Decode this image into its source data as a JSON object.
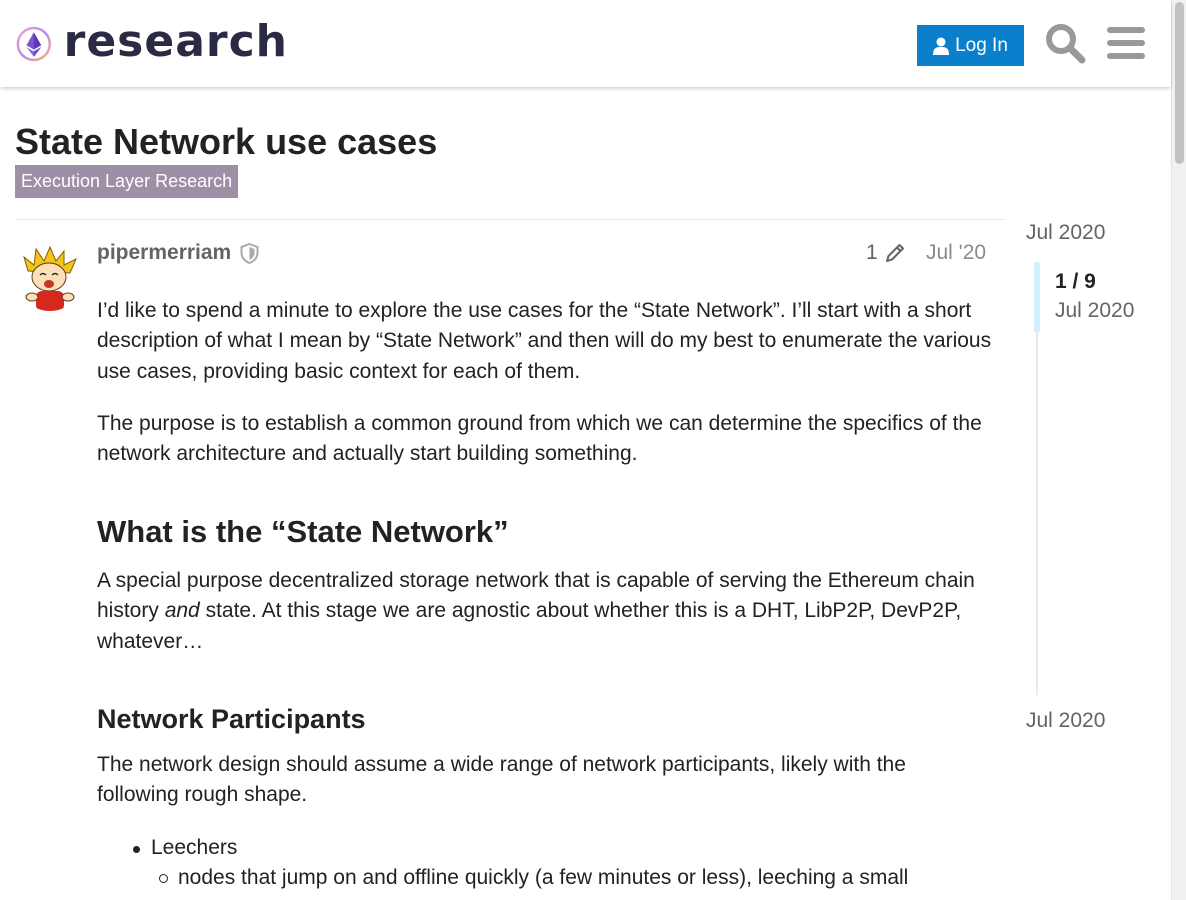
{
  "header": {
    "logo_text": "research",
    "login_label": "Log In",
    "search_icon": "search-icon",
    "menu_icon": "hamburger-menu-icon"
  },
  "topic": {
    "title": "State Network use cases",
    "category": "Execution Layer Research",
    "category_color": "#9c8fa6"
  },
  "post": {
    "username": "pipermerriam",
    "edit_count": "1",
    "date": "Jul '20",
    "paragraph_1": "I’d like to spend a minute to explore the use cases for the “State Network”. I’ll start with a short description of what I mean by “State Network” and then will do my best to enumerate the various use cases, providing basic context for each of them.",
    "paragraph_2": "The purpose is to establish a common ground from which we can determine the specifics of the network architecture and actually start building something.",
    "heading_1": "What is the “State Network”",
    "paragraph_3_before": "A special purpose decentralized storage network that is capable of serving the Ethereum chain history ",
    "paragraph_3_em": "and",
    "paragraph_3_after": " state. At this stage we are agnostic about whether this is a DHT, LibP2P, DevP2P, whatever…",
    "heading_2": "Network Participants",
    "paragraph_4": "The network design should assume a wide range of network participants, likely with the following rough shape.",
    "list_item_1": "Leechers",
    "list_subitem_1": "nodes that jump on and offline quickly (a few minutes or less), leeching a small"
  },
  "timeline": {
    "start_date": "Jul 2020",
    "position": "1 / 9",
    "position_date": "Jul 2020",
    "end_date": "Jul 2020"
  },
  "colors": {
    "accent": "#0a80cc",
    "timeline_handle": "#d1f0ff"
  }
}
